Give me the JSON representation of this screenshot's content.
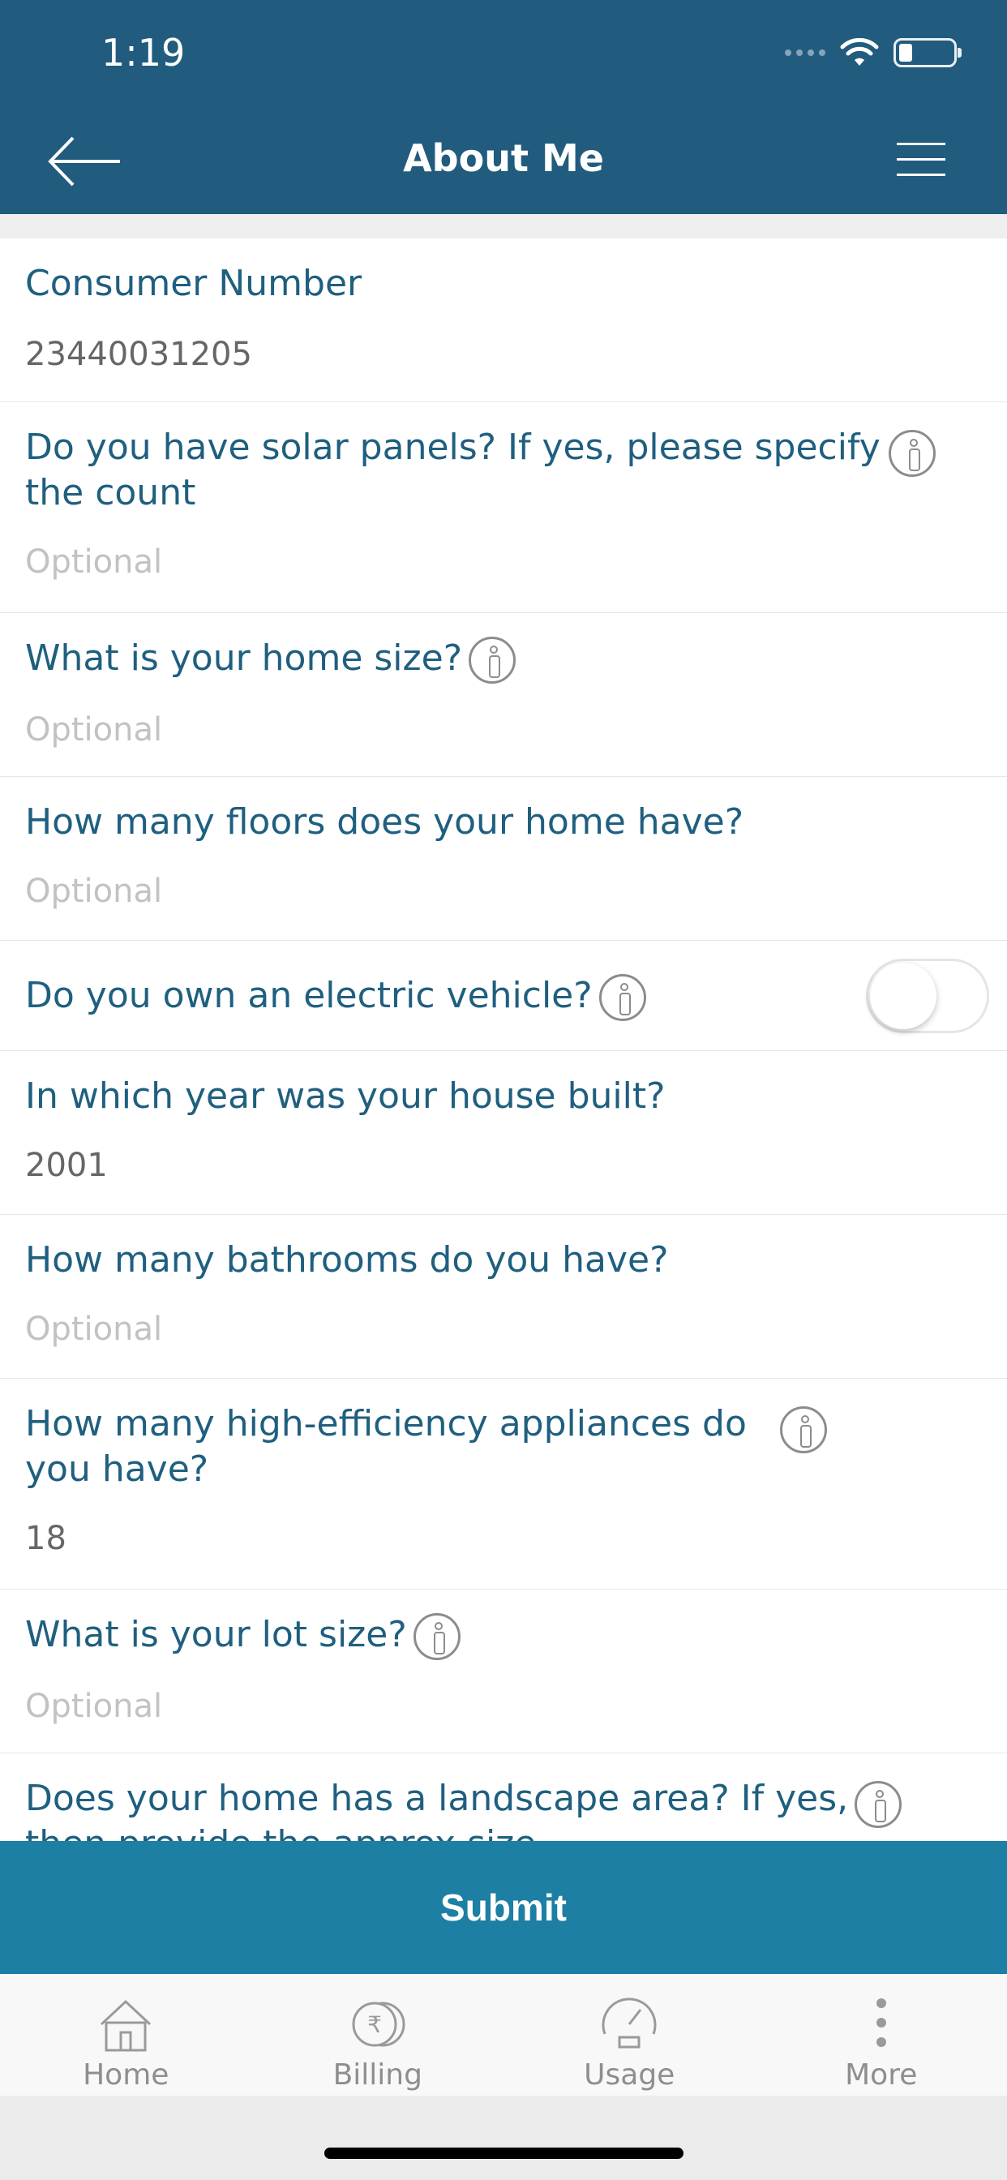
{
  "status_bar": {
    "time": "1:19"
  },
  "header": {
    "title": "About Me"
  },
  "form": {
    "fields": [
      {
        "question": "Consumer Number",
        "value": "23440031205"
      },
      {
        "question": "Do you have solar panels? If yes, please specify the count",
        "placeholder": "Optional"
      },
      {
        "question": "What is your home size?",
        "placeholder": "Optional"
      },
      {
        "question": "How many floors does your home have?",
        "placeholder": "Optional"
      },
      {
        "question": "Do you own an electric vehicle?",
        "toggle_on": false
      },
      {
        "question": "In which year was your house built?",
        "value": "2001"
      },
      {
        "question": "How many bathrooms do you have?",
        "placeholder": "Optional"
      },
      {
        "question": "How many high-efficiency appliances do you have?",
        "value": "18"
      },
      {
        "question": "What is your lot size?",
        "placeholder": "Optional"
      },
      {
        "question": "Does your home has a landscape area? If yes, then provide the approx size"
      }
    ]
  },
  "submit": {
    "label": "Submit"
  },
  "tabbar": {
    "items": [
      {
        "label": "Home",
        "icon": "home-icon"
      },
      {
        "label": "Billing",
        "icon": "rupee-coins-icon"
      },
      {
        "label": "Usage",
        "icon": "gauge-icon"
      },
      {
        "label": "More",
        "icon": "more-vertical-icon"
      }
    ]
  },
  "colors": {
    "header_bg": "#215c7f",
    "submit_bg": "#1d7fa3",
    "question_text": "#1f5f7f"
  }
}
